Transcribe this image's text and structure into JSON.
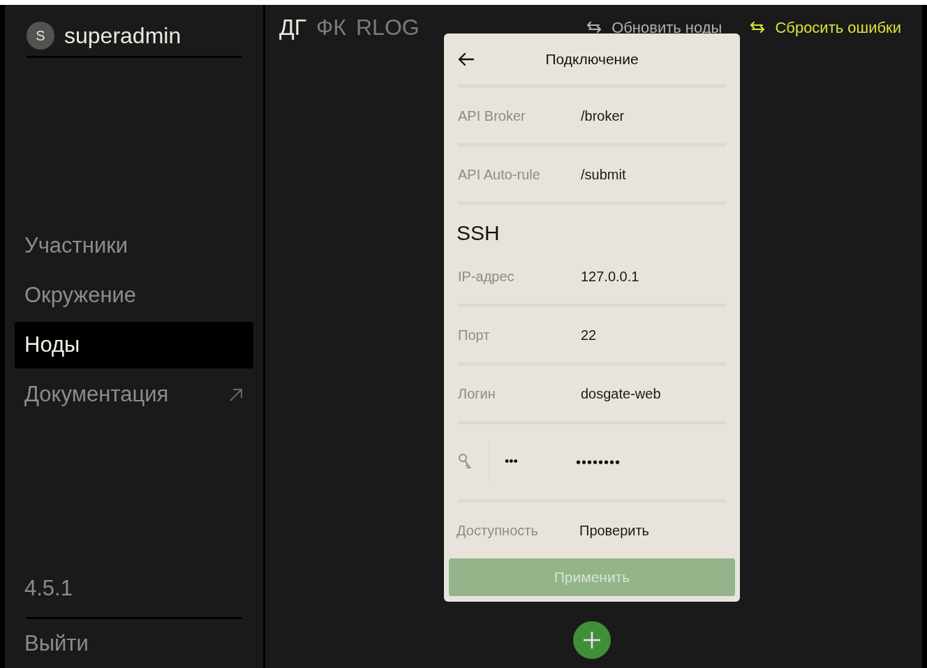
{
  "user": {
    "initial": "S",
    "name": "superadmin"
  },
  "nav": [
    {
      "label": "Участники",
      "selected": false,
      "external": false
    },
    {
      "label": "Окружение",
      "selected": false,
      "external": false
    },
    {
      "label": "Ноды",
      "selected": true,
      "external": false
    },
    {
      "label": "Документация",
      "selected": false,
      "external": true
    }
  ],
  "version": "4.5.1",
  "logout": "Выйти",
  "tabs": [
    {
      "label": "ДГ",
      "selected": true
    },
    {
      "label": "ФК",
      "selected": false
    },
    {
      "label": "RLOG",
      "selected": false
    }
  ],
  "actions": [
    {
      "label": "Обновить ноды",
      "highlighted": false
    },
    {
      "label": "Сбросить ошибки",
      "highlighted": true
    }
  ],
  "dialog": {
    "title": "Подключение",
    "rows": [
      {
        "kind": "field",
        "label": "API Broker",
        "value": "/broker"
      },
      {
        "kind": "field",
        "label": "API Auto-rule",
        "value": "/submit"
      },
      {
        "kind": "heading",
        "label": "SSH"
      },
      {
        "kind": "field",
        "label": "IP-адрес",
        "value": "127.0.0.1"
      },
      {
        "kind": "field",
        "label": "Порт",
        "value": "22"
      },
      {
        "kind": "field",
        "label": "Логин",
        "value": "dosgate-web"
      },
      {
        "kind": "secret",
        "label": "•••",
        "value": "••••••••"
      },
      {
        "kind": "action",
        "label": "Доступность",
        "value": "Проверить"
      }
    ],
    "apply": {
      "label": "Применить",
      "disabled": true
    }
  }
}
